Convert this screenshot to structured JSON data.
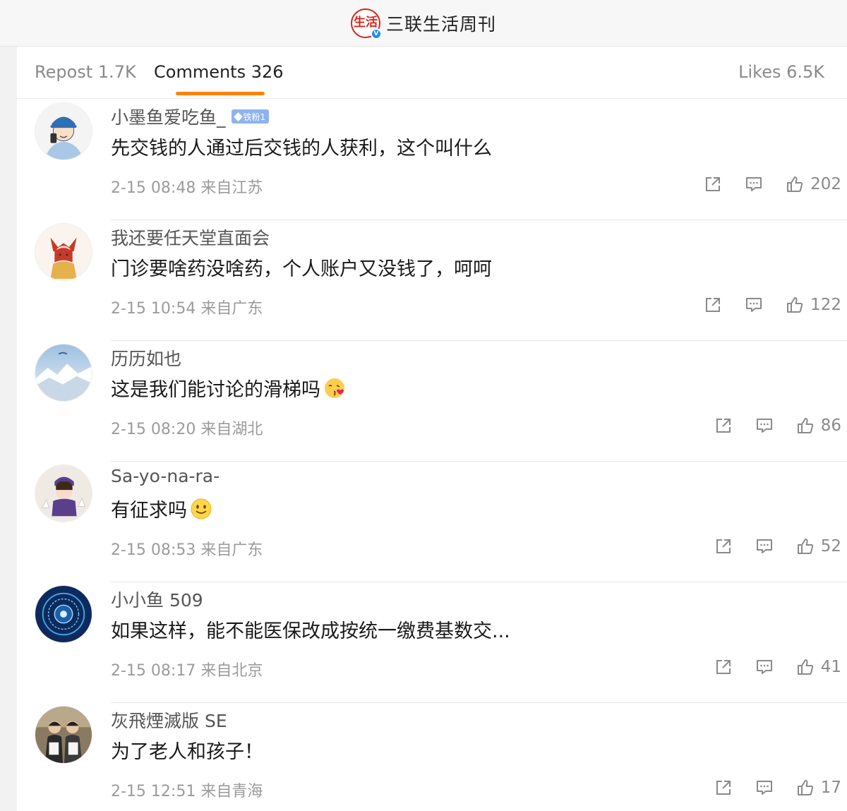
{
  "header": {
    "logo_text": "生活",
    "verified_mark": "V",
    "account_name": "三联生活周刊"
  },
  "tabs": {
    "repost": "Repost 1.7K",
    "comments": "Comments 326",
    "likes": "Likes 6.5K"
  },
  "colors": {
    "accent": "#ff8200",
    "brand_red": "#d6261d",
    "verified_blue": "#1a8ef2"
  },
  "icons": [
    "share-icon",
    "reply-icon",
    "thumbs-up-icon",
    "verified-icon",
    "fan-badge-diamond-icon"
  ],
  "comments": [
    {
      "username": "小墨鱼爱吃鱼_",
      "badge": "铁粉1",
      "text": "先交钱的人通过后交钱的人获利，这个叫什么",
      "emoji": "",
      "meta": "2-15 08:48 来自江苏",
      "likes": "202"
    },
    {
      "username": "我还要任天堂直面会",
      "badge": "",
      "text": "门诊要啥药没啥药，个人账户又没钱了，呵呵",
      "emoji": "",
      "meta": "2-15 10:54 来自广东",
      "likes": "122"
    },
    {
      "username": "历历如也",
      "badge": "",
      "text": "这是我们能讨论的滑梯吗",
      "emoji": "kiss-face-emoji",
      "meta": "2-15 08:20 来自湖北",
      "likes": "86"
    },
    {
      "username": "Sa-yo-na-ra-",
      "badge": "",
      "text": "有征求吗",
      "emoji": "smile-face-emoji",
      "meta": "2-15 08:53 来自广东",
      "likes": "52"
    },
    {
      "username": "小小鱼 509",
      "badge": "",
      "text": "如果这样，能不能医保改成按统一缴费基数交...",
      "emoji": "",
      "meta": "2-15 08:17 来自北京",
      "likes": "41"
    },
    {
      "username": "灰飛煙滅版 SE",
      "badge": "",
      "text": "为了老人和孩子！",
      "emoji": "",
      "meta": "2-15 12:51 来自青海",
      "likes": "17"
    }
  ]
}
